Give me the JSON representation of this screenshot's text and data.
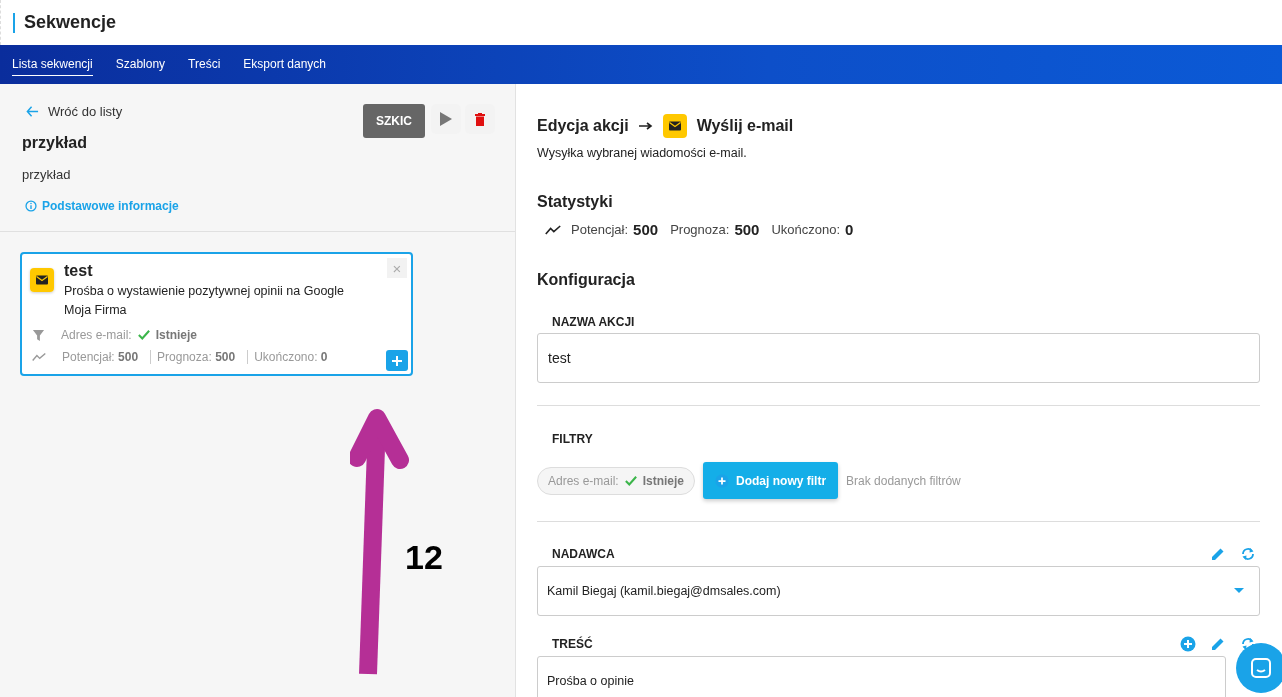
{
  "header": {
    "title": "Sekwencje"
  },
  "nav": {
    "tabs": [
      {
        "label": "Lista sekwencji",
        "selected": true
      },
      {
        "label": "Szablony",
        "selected": false
      },
      {
        "label": "Treści",
        "selected": false
      },
      {
        "label": "Eksport danych",
        "selected": false
      }
    ]
  },
  "sequence": {
    "back_link": "Wróć do listy",
    "status": "SZKIC",
    "name": "przykład",
    "description": "przykład",
    "info_link": "Podstawowe informacje"
  },
  "action_card": {
    "close": "×",
    "title": "test",
    "description": "Prośba o wystawienie pozytywnej opinii na Google Moja Firma",
    "filter": {
      "label": "Adres e-mail:",
      "value": "Istnieje"
    },
    "stats": [
      {
        "label": "Potencjał:",
        "value": "500"
      },
      {
        "label": "Prognoza:",
        "value": "500"
      },
      {
        "label": "Ukończono:",
        "value": "0"
      }
    ]
  },
  "annotation": {
    "label": "12"
  },
  "editor": {
    "breadcrumb": "Edycja akcji",
    "action_type": "Wyślij e-mail",
    "description": "Wysyłka wybranej wiadomości e-mail.",
    "stats_title": "Statystyki",
    "stats": [
      {
        "label": "Potencjał:",
        "value": "500"
      },
      {
        "label": "Prognoza:",
        "value": "500"
      },
      {
        "label": "Ukończono:",
        "value": "0"
      }
    ],
    "config_title": "Konfiguracja",
    "name_field": {
      "label": "NAZWA AKCJI",
      "value": "test"
    },
    "filters": {
      "label": "FILTRY",
      "chip": {
        "label": "Adres e-mail:",
        "value": "Istnieje"
      },
      "add_button": "Dodaj nowy filtr",
      "empty_text": "Brak dodanych filtrów"
    },
    "sender": {
      "label": "NADAWCA",
      "value": "Kamil Biegaj (kamil.biegaj@dmsales.com)"
    },
    "content": {
      "label": "TREŚĆ",
      "value": "Prośba o opinie"
    }
  }
}
